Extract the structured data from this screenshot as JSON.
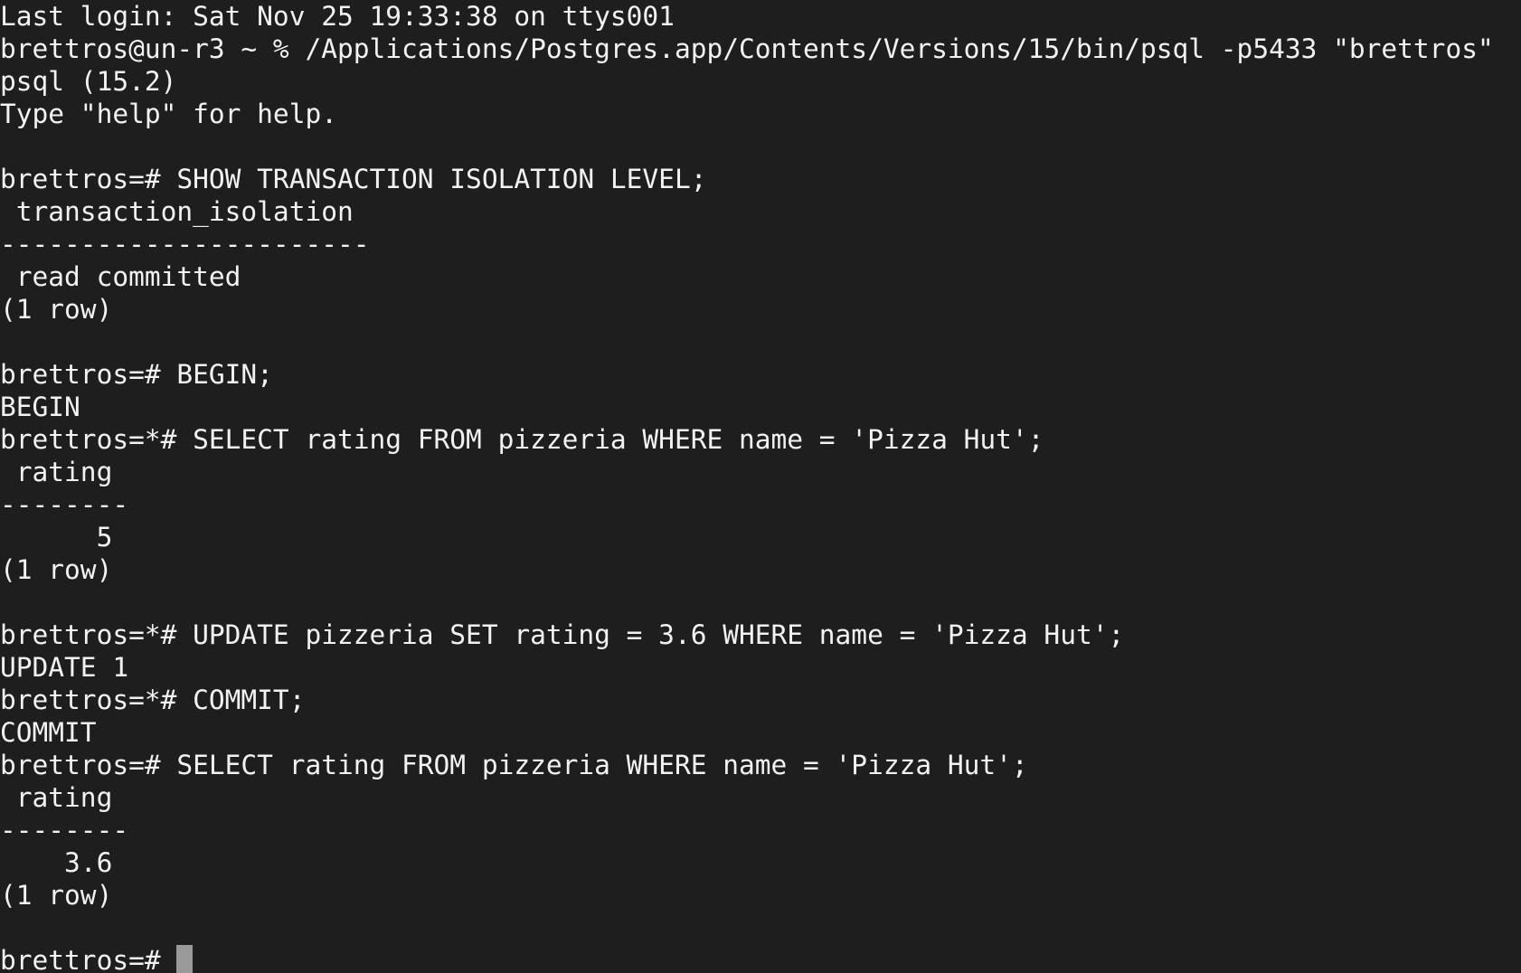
{
  "terminal": {
    "lines": [
      "Last login: Sat Nov 25 19:33:38 on ttys001",
      "brettros@un-r3 ~ % /Applications/Postgres.app/Contents/Versions/15/bin/psql -p5433 \"brettros\"",
      "psql (15.2)",
      "Type \"help\" for help.",
      "",
      "brettros=# SHOW TRANSACTION ISOLATION LEVEL;",
      " transaction_isolation",
      "-----------------------",
      " read committed",
      "(1 row)",
      "",
      "brettros=# BEGIN;",
      "BEGIN",
      "brettros=*# SELECT rating FROM pizzeria WHERE name = 'Pizza Hut';",
      " rating",
      "--------",
      "      5",
      "(1 row)",
      "",
      "brettros=*# UPDATE pizzeria SET rating = 3.6 WHERE name = 'Pizza Hut';",
      "UPDATE 1",
      "brettros=*# COMMIT;",
      "COMMIT",
      "brettros=# SELECT rating FROM pizzeria WHERE name = 'Pizza Hut';",
      " rating",
      "--------",
      "    3.6",
      "(1 row)",
      ""
    ],
    "final_prompt": "brettros=# "
  },
  "colors": {
    "background": "#1e1e1e",
    "foreground": "#f2f2f2",
    "cursor": "#9a9a9a"
  }
}
